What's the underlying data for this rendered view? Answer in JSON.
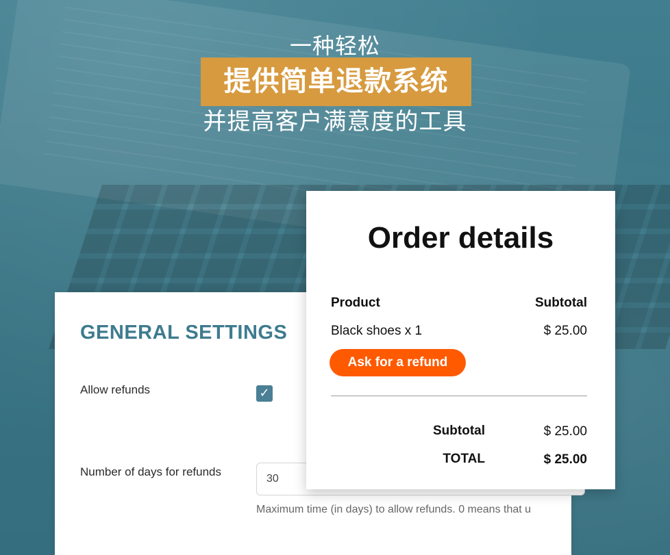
{
  "hero": {
    "line1": "一种轻松",
    "line2": "提供简单退款系统",
    "line3": "并提高客户满意度的工具",
    "highlight_color": "#d79a3f"
  },
  "settings": {
    "title": "GENERAL SETTINGS",
    "allow_refunds_label": "Allow refunds",
    "allow_refunds_checked": true,
    "days_label": "Number of days for refunds",
    "days_value": "30",
    "days_help": "Maximum time (in days) to allow refunds. 0 means that u",
    "accent_color": "#3e7b8f"
  },
  "order": {
    "title": "Order details",
    "col_product": "Product",
    "col_subtotal": "Subtotal",
    "item_name": "Black shoes x 1",
    "item_price": "$  25.00",
    "refund_button": "Ask for a refund",
    "subtotal_label": "Subtotal",
    "subtotal_value": "$  25.00",
    "total_label": "TOTAL",
    "total_value": "$ 25.00",
    "refund_button_color": "#ff5a00"
  },
  "icons": {
    "checkbox": "checkmark-icon"
  }
}
